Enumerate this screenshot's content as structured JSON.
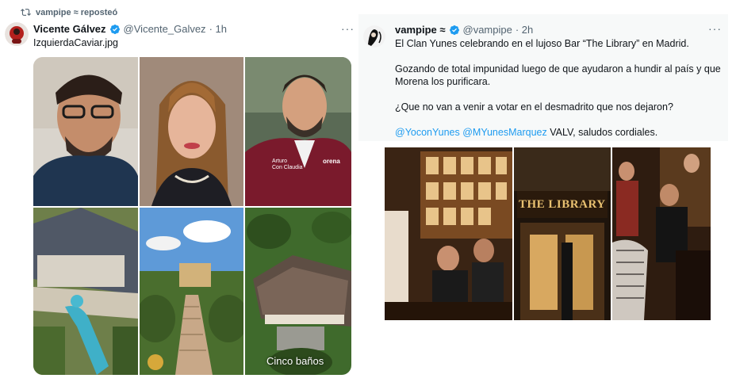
{
  "left_post": {
    "repost_label": "vampipe ≈ reposteó",
    "author_name": "Vicente Gálvez",
    "handle": "@Vicente_Galvez",
    "time": "· 1h",
    "text": "IzquierdaCaviar.jpg",
    "more": "···",
    "image_caption": "Cinco baños",
    "jacket_text_1": "Arturo",
    "jacket_text_2": "Con Claudia",
    "jacket_text_3": "orena"
  },
  "right_post": {
    "author_name": "vampipe ≈",
    "handle": "@vampipe",
    "time": "· 2h",
    "more": "···",
    "line1": "El Clan Yunes celebrando en el lujoso Bar “The Library” en Madrid.",
    "line2a": "Gozando de total impunidad luego de que ayudaron a hundir al país y que",
    "line2b": "Morena los purificara.",
    "line3": "¿Que no van a venir a votar en el desmadrito que nos dejaron?",
    "mention1": "@YoconYunes",
    "mention2": "@MYunesMarquez",
    "line4_rest": " VALV, saludos cordiales.",
    "sign_text": "THE LIBRARY"
  },
  "colors": {
    "verified": "#1d9bf0",
    "link": "#1d9bf0",
    "muted": "#536471"
  }
}
